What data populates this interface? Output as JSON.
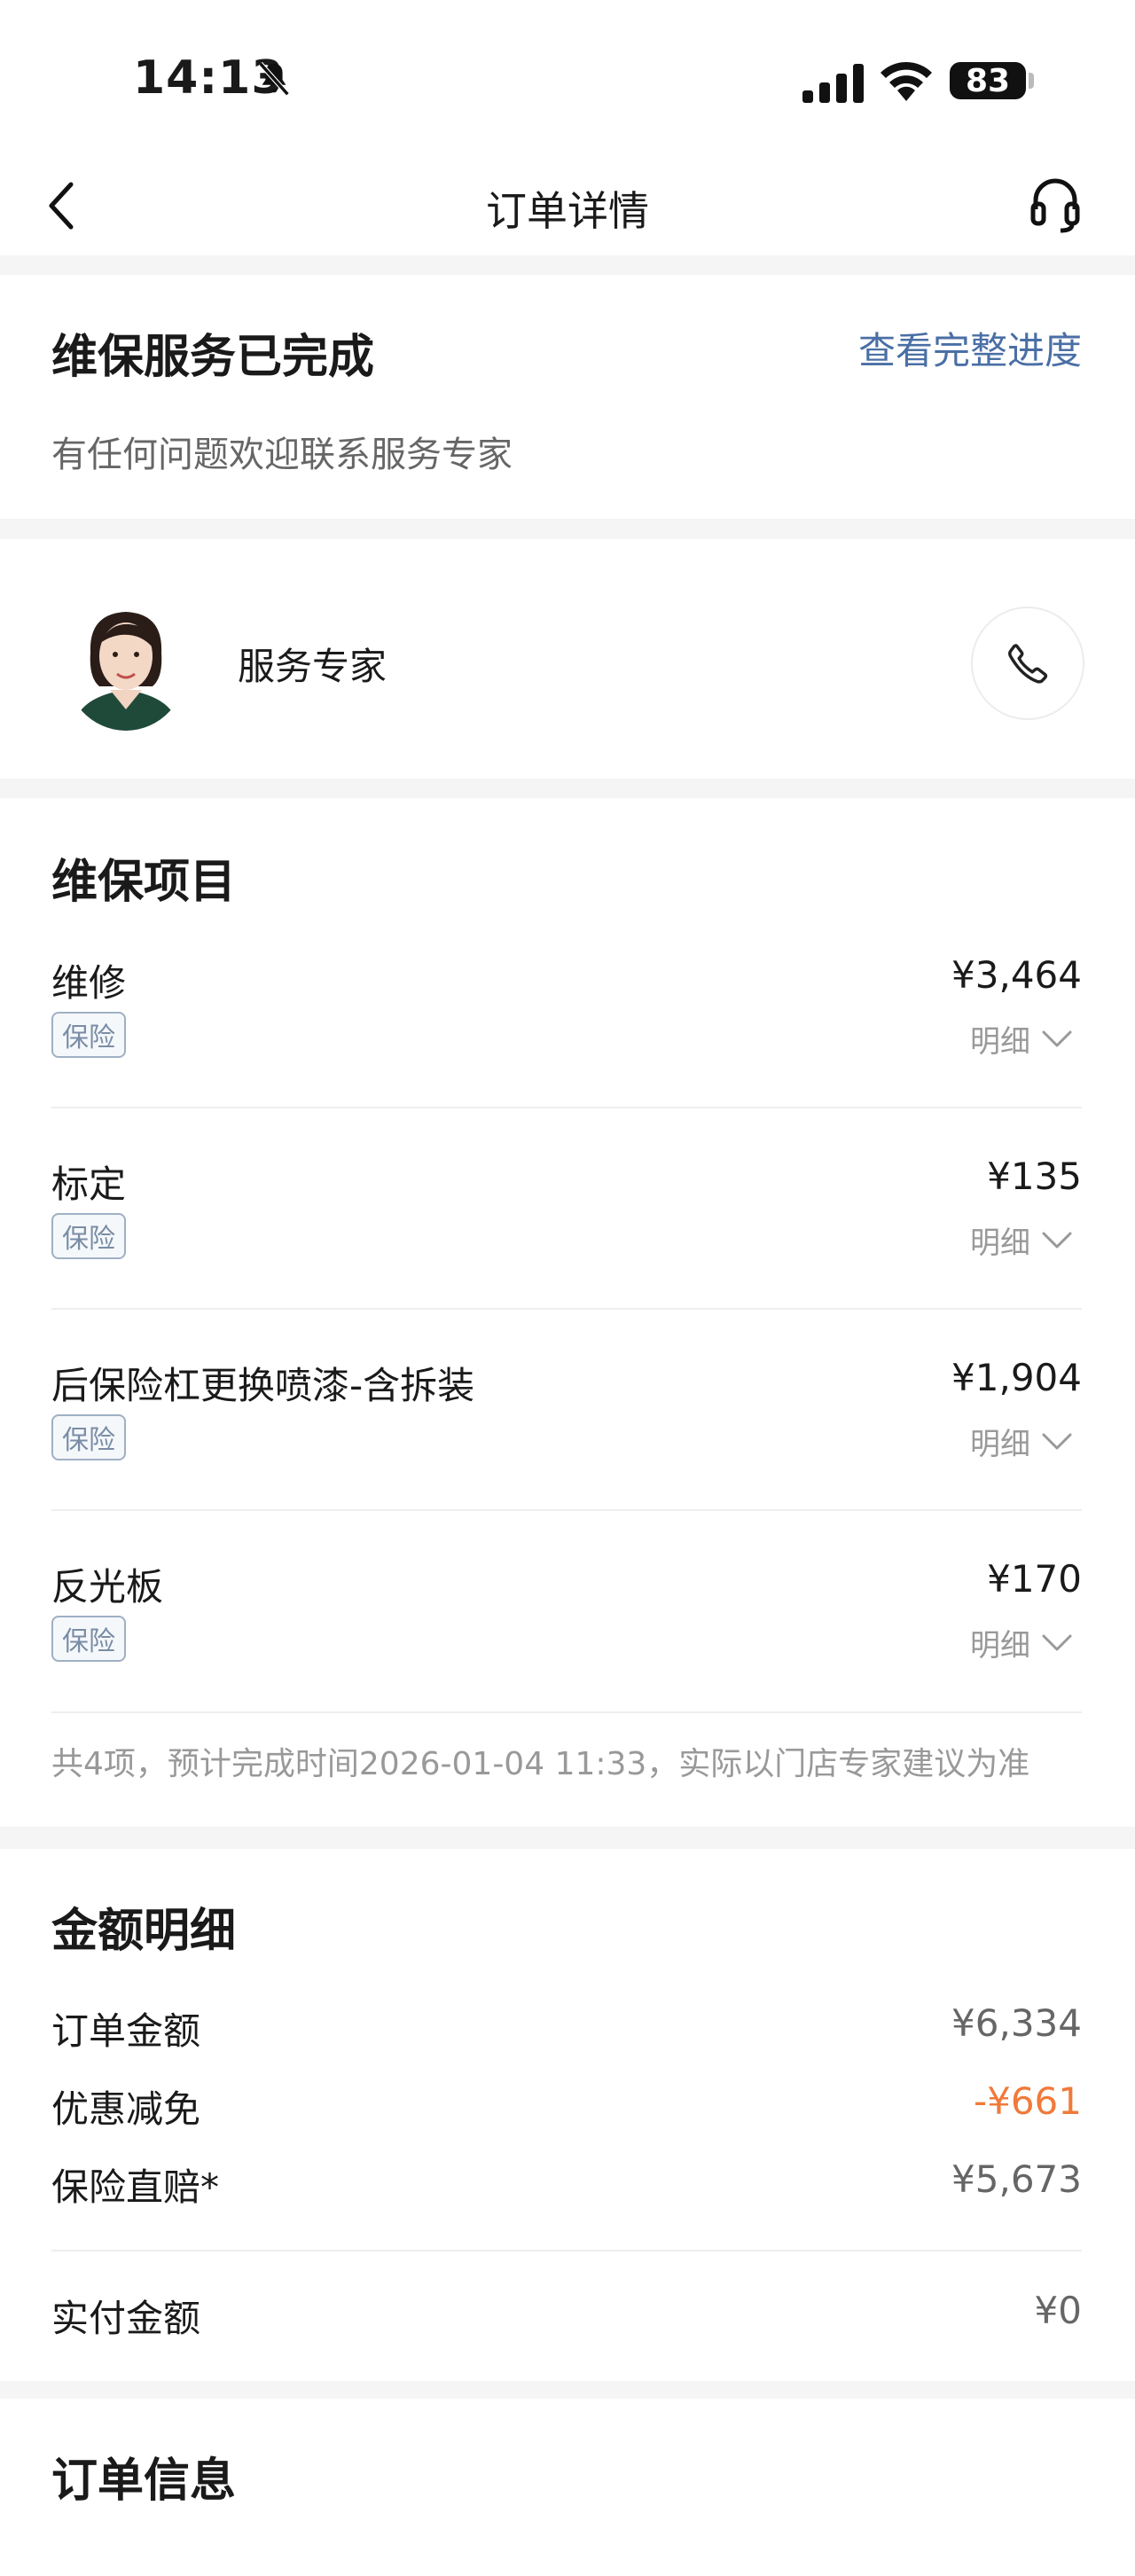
{
  "status_bar": {
    "time": "14:13",
    "battery": "83"
  },
  "nav": {
    "title": "订单详情",
    "back_icon": "chevron-left-icon",
    "service_icon": "headset-icon"
  },
  "status": {
    "title": "维保服务已完成",
    "link": "查看完整进度",
    "subtitle": "有任何问题欢迎联系服务专家"
  },
  "expert": {
    "label": "服务专家"
  },
  "maintenance": {
    "title": "维保项目",
    "items": [
      {
        "name": "维修",
        "price": "¥3,464",
        "tag": "保险",
        "detail": "明细"
      },
      {
        "name": "标定",
        "price": "¥135",
        "tag": "保险",
        "detail": "明细"
      },
      {
        "name": "后保险杠更换喷漆-含拆装",
        "price": "¥1,904",
        "tag": "保险",
        "detail": "明细"
      },
      {
        "name": "反光板",
        "price": "¥170",
        "tag": "保险",
        "detail": "明细"
      }
    ],
    "summary": "共4项，预计完成时间2026-01-04 11:33，实际以门店专家建议为准"
  },
  "amount": {
    "title": "金额明细",
    "rows": [
      {
        "label": "订单金额",
        "value": "¥6,334"
      },
      {
        "label": "优惠减免",
        "value": "-¥661"
      },
      {
        "label": "保险直赔*",
        "value": "¥5,673"
      }
    ],
    "paid": {
      "label": "实付金额",
      "value": "¥0"
    }
  },
  "order_info": {
    "title": "订单信息"
  },
  "colors": {
    "link": "#4a6fa5",
    "discount": "#f07a3a",
    "tag_border": "#9fb0c4"
  }
}
